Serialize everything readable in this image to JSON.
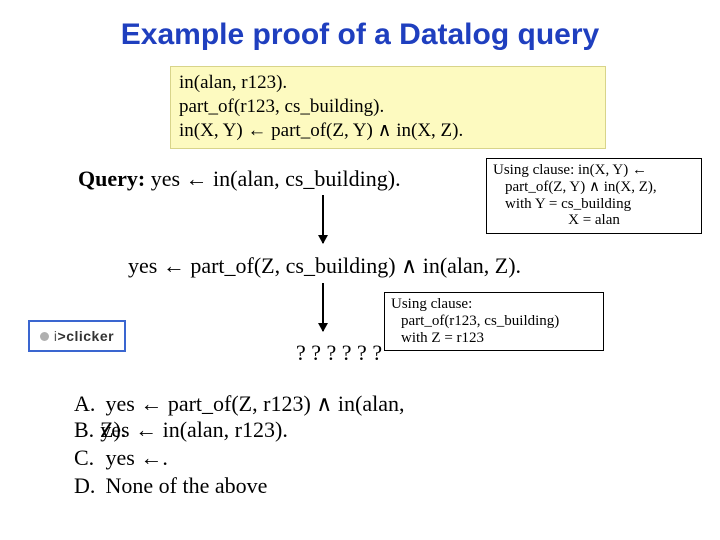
{
  "title": "Example proof of a Datalog query",
  "facts": {
    "line1": "in(alan, r123).",
    "line2": "part_of(r123, cs_building).",
    "line3": "in(X, Y) ← part_of(Z, Y) ∧ in(X, Z)."
  },
  "query": {
    "label": "Query:",
    "text": "  yes ← in(alan, cs_building)."
  },
  "note1": {
    "l1": "Using clause: in(X, Y) ←",
    "l2": "part_of(Z, Y) ∧ in(X, Z),",
    "l3": "with Y = cs_building",
    "l4": "X = alan"
  },
  "step2": "yes ← part_of(Z, cs_building) ∧ in(alan, Z).",
  "note2": {
    "l1": "Using clause:",
    "l2": "part_of(r123, cs_building)",
    "l3": "with Z = r123"
  },
  "qmarks": "? ? ? ? ? ?",
  "answers": {
    "a_label": "A.",
    "a_text": "yes ← part_of(Z, r123) ∧ in(alan,",
    "a_tail": "Z).",
    "b_label": "B.",
    "b_text": "yes ← in(alan, r123).",
    "c_label": "C.",
    "c_text": "yes ←.",
    "d_label": "D.",
    "d_text": "None of the above"
  },
  "iclicker": {
    "brand_prefix": "i",
    "brand_bold": ">clicker"
  }
}
